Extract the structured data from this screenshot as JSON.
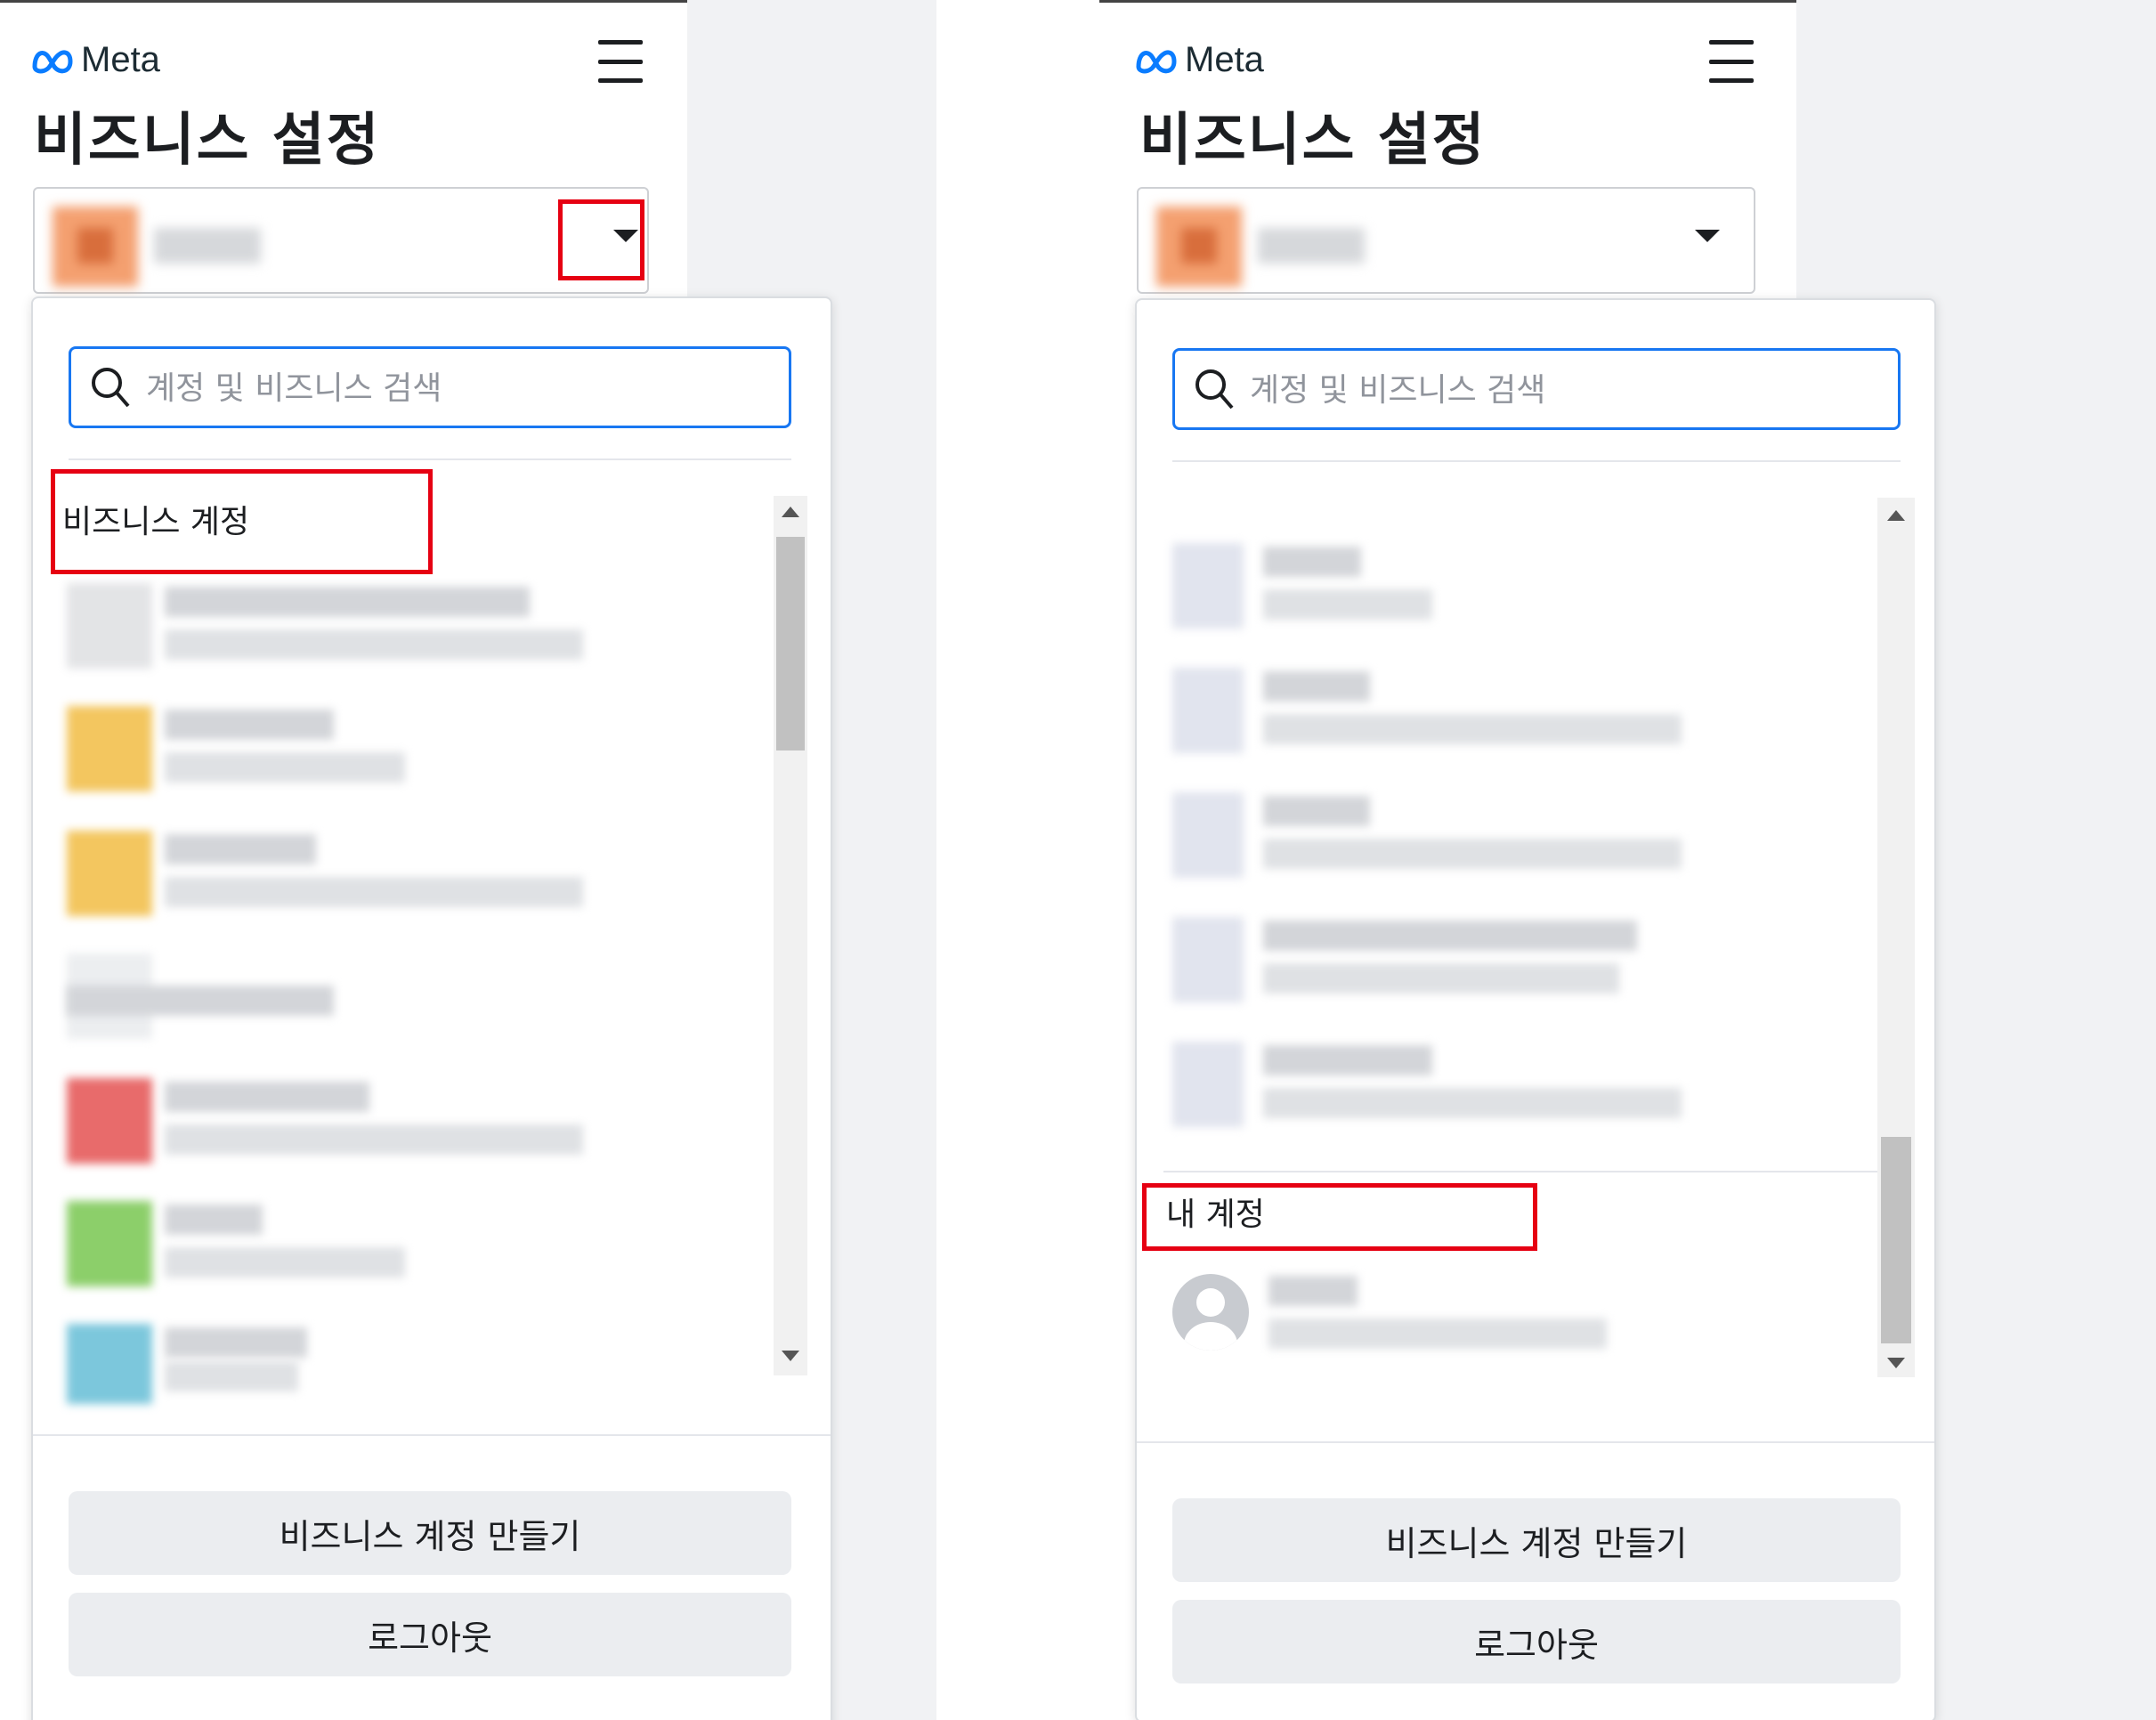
{
  "left": {
    "brand": "Meta",
    "title": "비즈니스 설정",
    "search_placeholder": "계정 및 비즈니스 검색",
    "section_label": "비즈니스 계정",
    "buttons": {
      "create": "비즈니스 계정 만들기",
      "logout": "로그아웃"
    }
  },
  "right": {
    "brand": "Meta",
    "title": "비즈니스 설정",
    "search_placeholder": "계정 및 비즈니스 검색",
    "section_label": "내 계정",
    "buttons": {
      "create": "비즈니스 계정 만들기",
      "logout": "로그아웃"
    }
  },
  "colors": {
    "accent": "#1877f2",
    "highlight": "#e60012"
  },
  "icons": [
    "meta-logo-icon",
    "hamburger-menu-icon",
    "caret-down-icon",
    "search-icon",
    "default-user-icon"
  ]
}
